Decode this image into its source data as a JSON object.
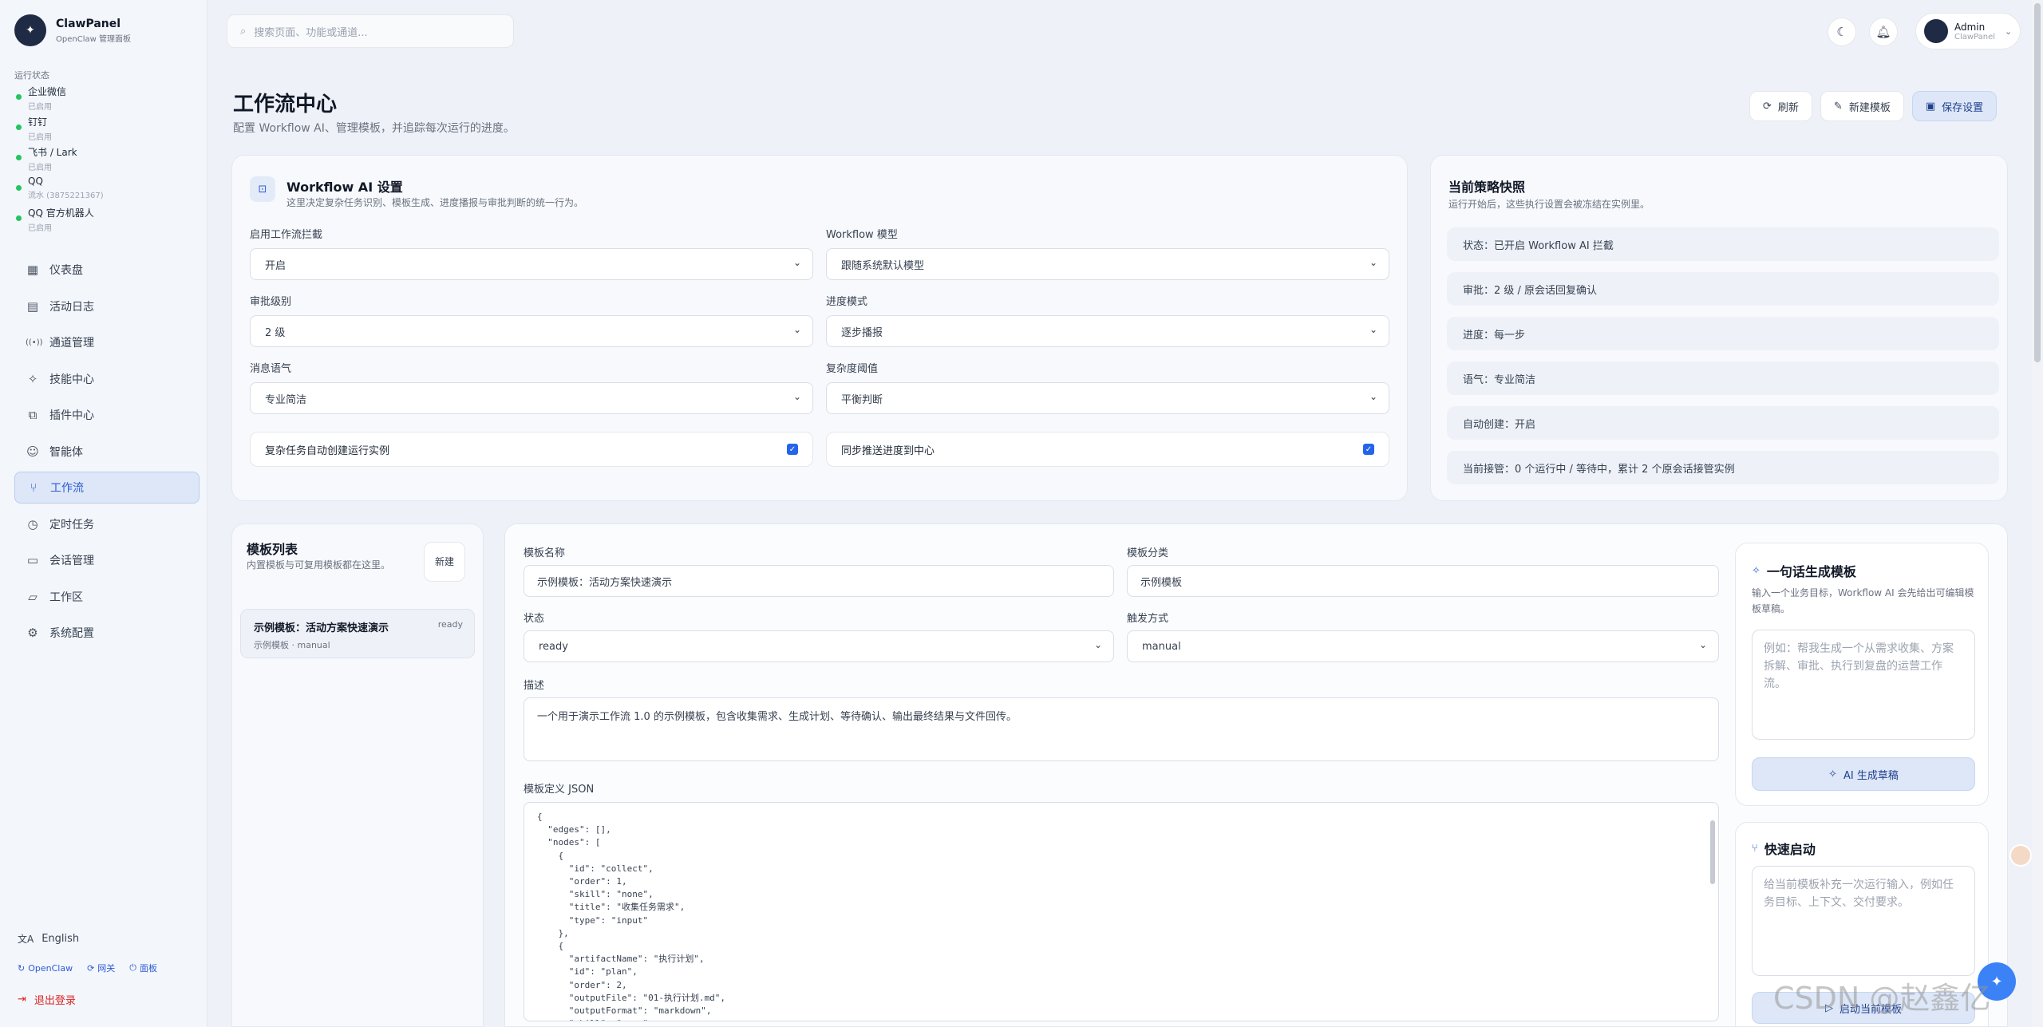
{
  "brand": {
    "title": "ClawPanel",
    "subtitle": "OpenClaw 管理面板",
    "logo_icon": "claw-logo"
  },
  "sidebar": {
    "section_label": "运行状态",
    "channels": [
      {
        "name": "企业微信",
        "status": "已启用"
      },
      {
        "name": "钉钉",
        "status": "已启用"
      },
      {
        "name": "飞书 / Lark",
        "status": "已启用"
      },
      {
        "name": "QQ",
        "status": "流水 (3875221367)"
      },
      {
        "name": "QQ 官方机器人",
        "status": "已启用"
      }
    ],
    "nav": [
      {
        "label": "仪表盘",
        "icon": "▦"
      },
      {
        "label": "活动日志",
        "icon": "▤"
      },
      {
        "label": "通道管理",
        "icon": "((•))"
      },
      {
        "label": "技能中心",
        "icon": "✧"
      },
      {
        "label": "插件中心",
        "icon": "⧉"
      },
      {
        "label": "智能体",
        "icon": "☺"
      },
      {
        "label": "工作流",
        "icon": "⑂"
      },
      {
        "label": "定时任务",
        "icon": "◷"
      },
      {
        "label": "会话管理",
        "icon": "▭"
      },
      {
        "label": "工作区",
        "icon": "▱"
      },
      {
        "label": "系统配置",
        "icon": "⚙"
      }
    ],
    "active_index": 6,
    "language": "English",
    "links": {
      "openclaw": "OpenClaw",
      "gateway": "网关",
      "panel": "面板"
    },
    "logout": "退出登录"
  },
  "topbar": {
    "search_placeholder": "搜索页面、功能或通道...",
    "user_name": "Admin",
    "user_role": "ClawPanel"
  },
  "header": {
    "title": "工作流中心",
    "subtitle": "配置 Workflow AI、管理模板，并追踪每次运行的进度。",
    "refresh": "刷新",
    "new_template": "新建模板",
    "save": "保存设置"
  },
  "ai_settings": {
    "title": "Workflow AI 设置",
    "subtitle": "这里决定复杂任务识别、模板生成、进度播报与审批判断的统一行为。",
    "fields": {
      "intercept_label": "启用工作流拦截",
      "intercept_value": "开启",
      "model_label": "Workflow 模型",
      "model_value": "跟随系统默认模型",
      "approval_label": "审批级别",
      "approval_value": "2 级",
      "progress_label": "进度模式",
      "progress_value": "逐步播报",
      "tone_label": "消息语气",
      "tone_value": "专业简洁",
      "complexity_label": "复杂度阈值",
      "complexity_value": "平衡判断"
    },
    "check_auto": "复杂任务自动创建运行实例",
    "check_sync": "同步推送进度到中心"
  },
  "snapshot": {
    "title": "当前策略快照",
    "subtitle": "运行开始后，这些执行设置会被冻结在实例里。",
    "rows": [
      "状态：已开启 Workflow AI 拦截",
      "审批：2 级 / 原会话回复确认",
      "进度：每一步",
      "语气：专业简洁",
      "自动创建：开启",
      "当前接管：0 个运行中 / 等待中，累计 2 个原会话接管实例"
    ]
  },
  "templates": {
    "title": "模板列表",
    "subtitle": "内置模板与可复用模板都在这里。",
    "new_btn": "新建",
    "items": [
      {
        "name": "示例模板：活动方案快速演示",
        "status": "ready",
        "meta": "示例模板 · manual"
      }
    ]
  },
  "editor": {
    "name_label": "模板名称",
    "name_value": "示例模板：活动方案快速演示",
    "category_label": "模板分类",
    "category_value": "示例模板",
    "status_label": "状态",
    "status_value": "ready",
    "trigger_label": "触发方式",
    "trigger_value": "manual",
    "desc_label": "描述",
    "desc_value": "一个用于演示工作流 1.0 的示例模板，包含收集需求、生成计划、等待确认、输出最终结果与文件回传。",
    "json_label": "模板定义 JSON",
    "json_text": "{\n  \"edges\": [],\n  \"nodes\": [\n    {\n      \"id\": \"collect\",\n      \"order\": 1,\n      \"skill\": \"none\",\n      \"title\": \"收集任务需求\",\n      \"type\": \"input\"\n    },\n    {\n      \"artifactName\": \"执行计划\",\n      \"id\": \"plan\",\n      \"order\": 2,\n      \"outputFile\": \"01-执行计划.md\",\n      \"outputFormat\": \"markdown\",\n      \"skill\": \"none\","
  },
  "generate": {
    "title": "一句话生成模板",
    "subtitle": "输入一个业务目标，Workflow AI 会先给出可编辑模板草稿。",
    "placeholder": "例如：帮我生成一个从需求收集、方案拆解、审批、执行到复盘的运营工作流。",
    "btn": "AI 生成草稿"
  },
  "quick": {
    "title": "快速启动",
    "placeholder": "给当前模板补充一次运行输入，例如任务目标、上下文、交付要求。",
    "btn": "启动当前模板"
  },
  "watermark": "CSDN @赵鑫亿"
}
